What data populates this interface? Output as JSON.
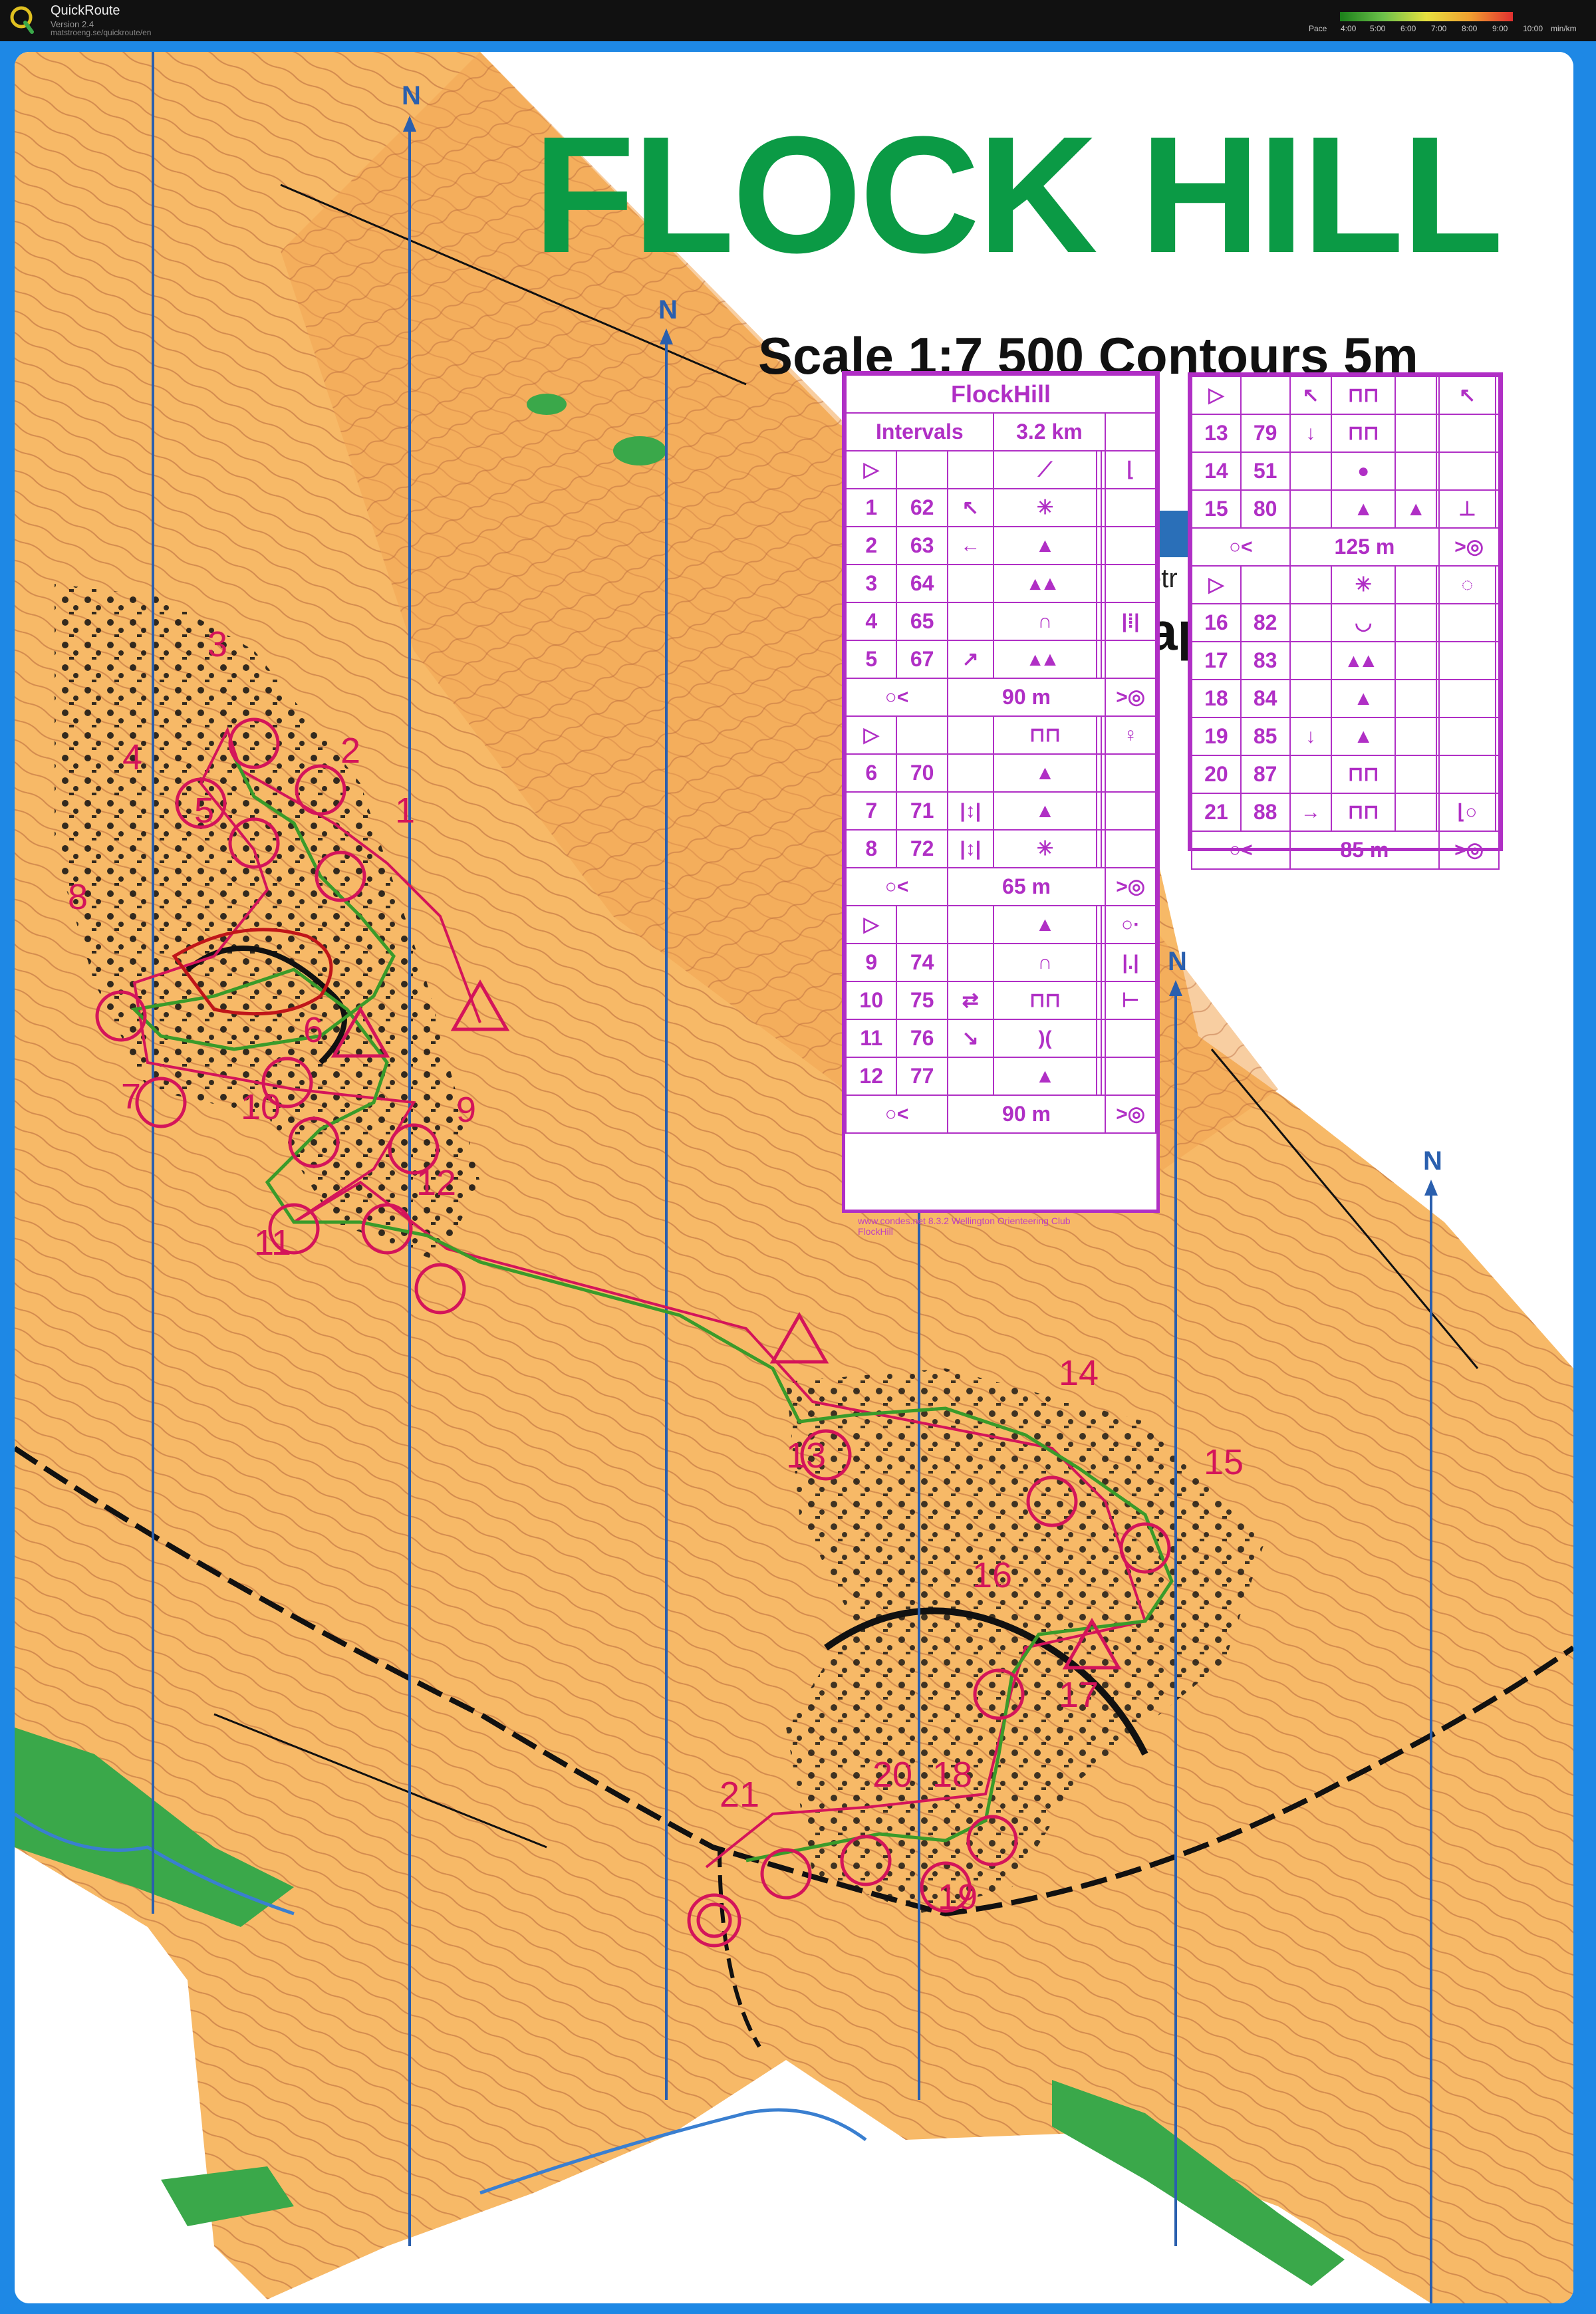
{
  "app": {
    "name": "QuickRoute",
    "version": "Version 2.4",
    "url": "matstroeng.se/quickroute/en"
  },
  "pace_legend": {
    "label": "Pace",
    "ticks": [
      "4:00",
      "5:00",
      "6:00",
      "7:00",
      "8:00",
      "9:00",
      "10:00"
    ],
    "unit": "min/km",
    "colors": [
      "#1a7f1a",
      "#6cc04a",
      "#e6e040",
      "#f0a030",
      "#e03030"
    ]
  },
  "map": {
    "title": "FLOCK HILL",
    "scale_text": "Scale 1:7 500  Contours 5m",
    "north_label": "N",
    "event_text": "www.condes.net 8.3.2 Wellington Orienteering Club",
    "event_text_2": "FlockHill",
    "colors": {
      "open_land": "#f7b967",
      "forest_white": "#ffffff",
      "contour": "#a0522d",
      "course": "#d4145a",
      "route": "#3a9b2a",
      "title_green": "#0b9a45",
      "meridian": "#2a5fae",
      "frame": "#1e88e5"
    }
  },
  "controls": [
    "1",
    "2",
    "3",
    "4",
    "5",
    "6",
    "7",
    "8",
    "9",
    "10",
    "11",
    "12",
    "13",
    "14",
    "15",
    "16",
    "17",
    "18",
    "19",
    "20",
    "21"
  ],
  "descriptions_left": {
    "title": "FlockHill",
    "intervals_label": "Intervals",
    "length": "3.2 km",
    "rows": [
      [
        "1",
        "62"
      ],
      [
        "2",
        "63"
      ],
      [
        "3",
        "64"
      ],
      [
        "4",
        "65"
      ],
      [
        "5",
        "67"
      ],
      [
        "6",
        "70"
      ],
      [
        "7",
        "71"
      ],
      [
        "8",
        "72"
      ],
      [
        "9",
        "74"
      ],
      [
        "10",
        "75"
      ],
      [
        "11",
        "76"
      ],
      [
        "12",
        "77"
      ]
    ],
    "marked_routes": [
      "90 m",
      "65 m",
      "90 m"
    ]
  },
  "descriptions_right": {
    "rows": [
      [
        "13",
        "79"
      ],
      [
        "14",
        "51"
      ],
      [
        "15",
        "80"
      ],
      [
        "16",
        "82"
      ],
      [
        "17",
        "83"
      ],
      [
        "18",
        "84"
      ],
      [
        "19",
        "85"
      ],
      [
        "20",
        "87"
      ],
      [
        "21",
        "88"
      ]
    ],
    "marked_routes": [
      "125 m",
      "85 m"
    ]
  },
  "obscured_text": {
    "a": "etr",
    "b": "ap"
  }
}
